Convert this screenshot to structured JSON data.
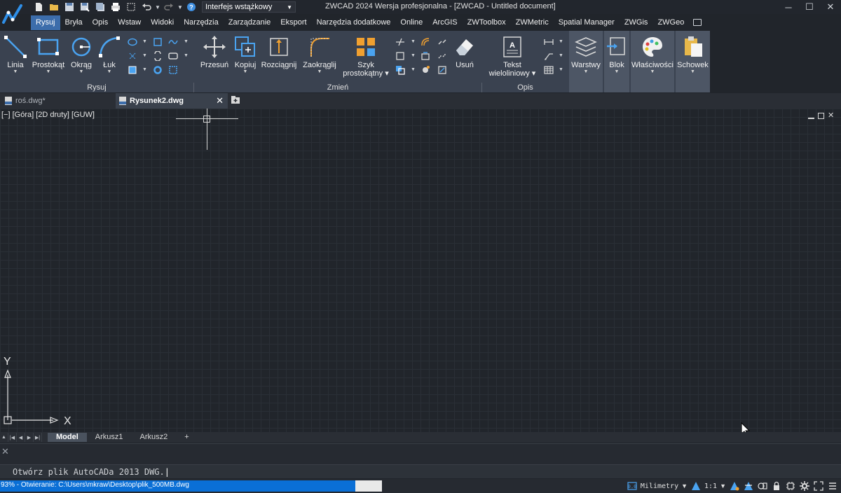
{
  "titlebar": {
    "title": "ZWCAD 2024 Wersja profesjonalna - [ZWCAD - Untitled document]",
    "workspace": "Interfejs wstążkowy"
  },
  "menu": [
    {
      "label": "Rysuj",
      "active": true
    },
    {
      "label": "Bryła"
    },
    {
      "label": "Opis"
    },
    {
      "label": "Wstaw"
    },
    {
      "label": "Widoki"
    },
    {
      "label": "Narzędzia"
    },
    {
      "label": "Zarządzanie"
    },
    {
      "label": "Eksport"
    },
    {
      "label": "Narzędzia dodatkowe"
    },
    {
      "label": "Online"
    },
    {
      "label": "ArcGIS"
    },
    {
      "label": "ZWToolbox"
    },
    {
      "label": "ZWMetric"
    },
    {
      "label": "Spatial Manager"
    },
    {
      "label": "ZWGis"
    },
    {
      "label": "ZWGeo"
    }
  ],
  "ribbon": {
    "draw": {
      "group": "Rysuj",
      "line": "Linia",
      "rect": "Prostokąt",
      "circle": "Okrąg",
      "arc": "Łuk"
    },
    "modify": {
      "group": "Zmień",
      "move": "Przesuń",
      "copy": "Kopiuj",
      "stretch": "Rozciągnij",
      "fillet": "Zaokrąglij",
      "array_1": "Szyk",
      "array_2": "prostokątny",
      "erase": "Usuń"
    },
    "annot": {
      "group": "Opis",
      "mtext_1": "Tekst",
      "mtext_2": "wieloliniowy"
    },
    "layers": "Warstwy",
    "block": "Blok",
    "props": "Właściwości",
    "clipboard": "Schowek"
  },
  "tabs": {
    "inactive": "roś.dwg*",
    "active": "Rysunek2.dwg"
  },
  "viewport": {
    "label": "[−] [Góra] [2D druty] [GUW]",
    "ucs_x": "X",
    "ucs_y": "Y"
  },
  "layouts": {
    "model": "Model",
    "sheet1": "Arkusz1",
    "sheet2": "Arkusz2",
    "add": "+"
  },
  "command": {
    "prompt": "Otwórz plik AutoCADa 2013 DWG."
  },
  "status": {
    "progress_text": "93% - Otwieranie: C:\\Users\\mkraw\\Desktop\\plik_500MB.dwg",
    "progress_percent": 93,
    "units": "Milimetry",
    "scale": "1:1"
  },
  "colors": {
    "accent": "#3c6dab",
    "progress": "#0a6fd6",
    "ribbon": "#3a4250",
    "background": "#21252b"
  }
}
